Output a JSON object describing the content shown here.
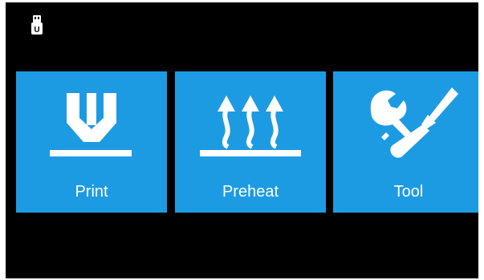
{
  "status_bar": {
    "usb_icon": "usb-drive-icon",
    "usb_letter": "U"
  },
  "menu": {
    "tile_color": "#1d9be2",
    "print_label": "Print",
    "print_icon": "nozzle-bed-icon",
    "preheat_label": "Preheat",
    "preheat_icon": "heat-waves-icon",
    "tool_label": "Tool",
    "tool_icon": "wrench-screwdriver-icon"
  }
}
